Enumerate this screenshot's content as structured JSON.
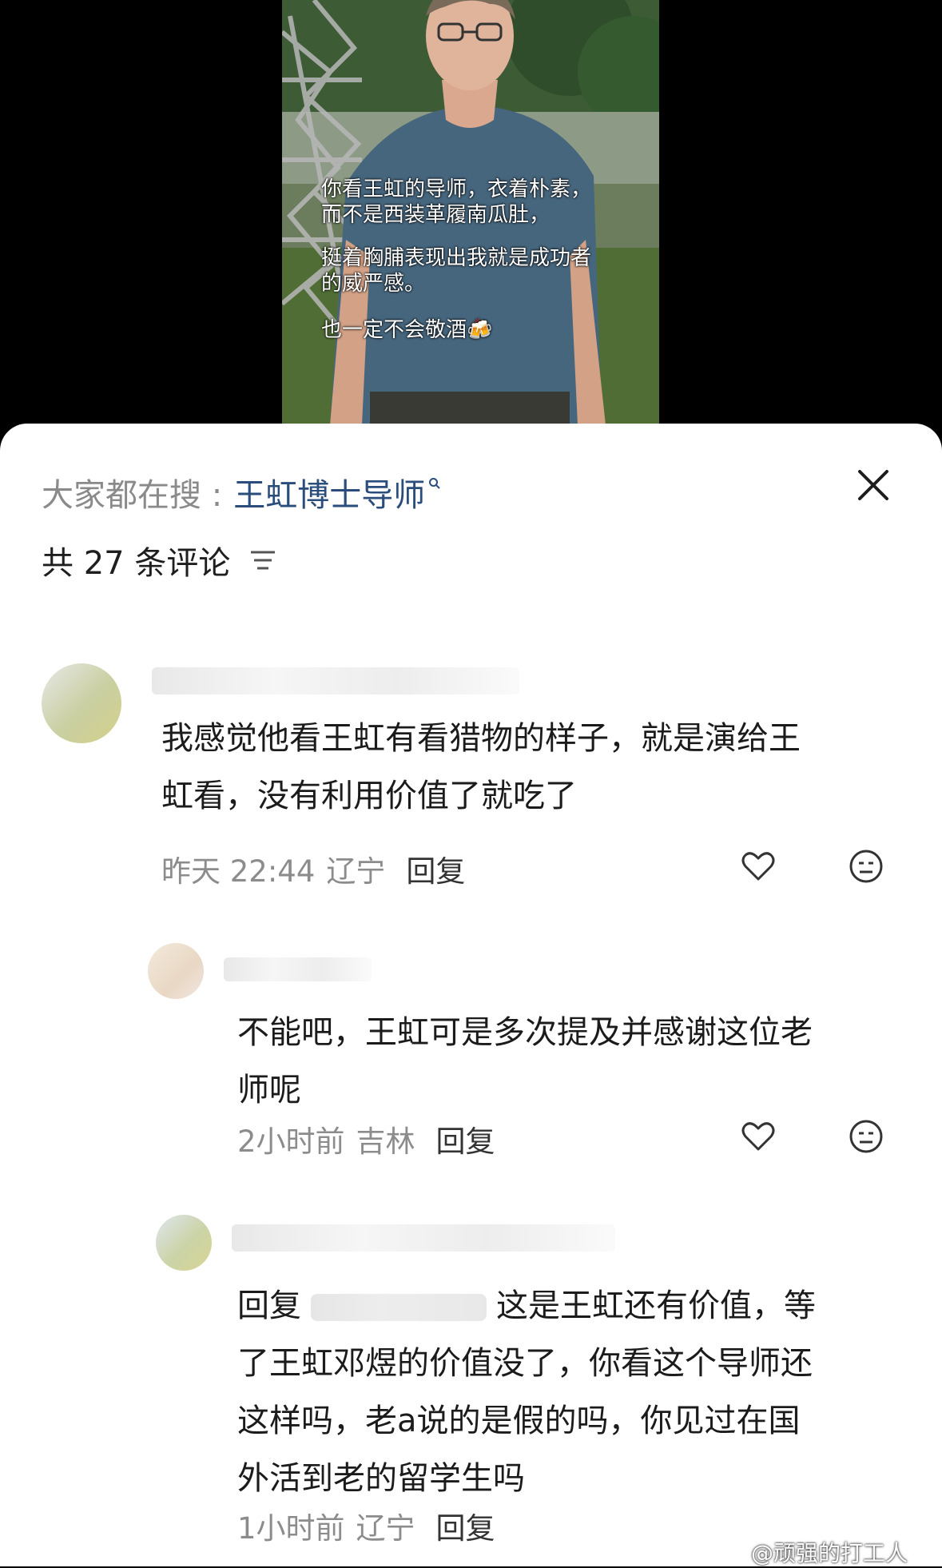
{
  "video": {
    "caption_lines": [
      "你看王虹的导师，衣着朴素，",
      "而不是西装革履南瓜肚，",
      "挺着胸脯表现出我就是成功者",
      "的威严感。",
      "也一定不会敬酒🍻"
    ]
  },
  "sheet": {
    "search_prefix": "大家都在搜 :",
    "search_term": "王虹博士导师",
    "comment_count": "共 27 条评论",
    "icons": [
      "close-icon",
      "sort-icon",
      "heart-icon",
      "dislike-face-icon"
    ],
    "colors": {
      "search_term": "#2a4d7c",
      "meta": "#8c8c8c"
    }
  },
  "comments": [
    {
      "text_lines": [
        "我感觉他看王虹有看猎物的样子，就是演给王",
        "虹看，没有利用价值了就吃了"
      ],
      "time": "昨天 22:44",
      "location": "辽宁",
      "reply_label": "回复"
    },
    {
      "text_lines": [
        "不能吧，王虹可是多次提及并感谢这位老",
        "师呢"
      ],
      "time": "2小时前",
      "location": "吉林",
      "reply_label": "回复"
    },
    {
      "reply_prefix": "回复",
      "line1_rest": "这是王虹还有价值，等",
      "text_lines": [
        "了王虹邓煜的价值没了，你看这个导师还",
        "这样吗，老a说的是假的吗，你见过在国",
        "外活到老的留学生吗"
      ],
      "time": "1小时前",
      "location": "辽宁",
      "reply_label": "回复"
    }
  ],
  "watermark": "@顽强的打工人"
}
